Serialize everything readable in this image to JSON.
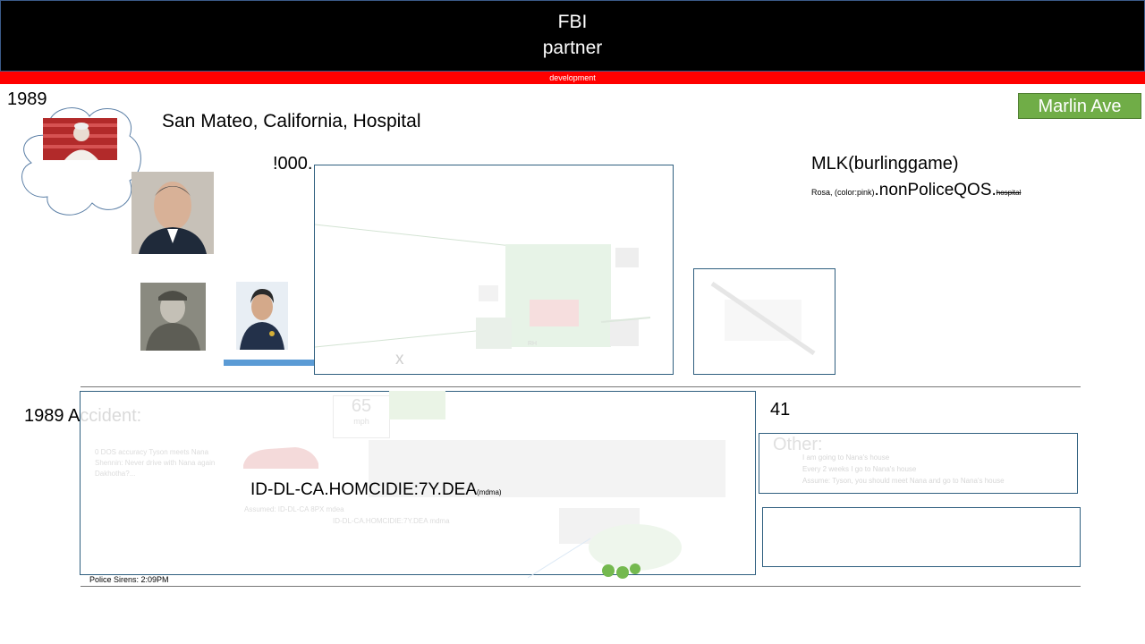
{
  "header": {
    "title_line1": "FBI",
    "title_line2": "partner",
    "subbar_text": "development"
  },
  "top": {
    "year": "1989",
    "location": "San Mateo, California, Hospital",
    "marlin_button": "Marlin Ave",
    "count_label": "!000.",
    "mlk_title": "MLK(burlinggame)",
    "rosa_prefix": "Rosa, (color:pink)",
    "rosa_main": ".nonPoliceQOS.",
    "rosa_strike": "hospital",
    "map_x_label": "x",
    "map_caption": "RH"
  },
  "accident": {
    "title": "1989 Accident:",
    "speed_value": "65",
    "speed_unit": "mph",
    "faint_notes": [
      "0 DOS accuracy Tyson meets Nana",
      "Shennin: Never drive with Nana again",
      "Dakhotha?..."
    ],
    "id_main": "ID-DL-CA.HOMCIDIE:7Y.DEA",
    "id_sub": "(mdma)",
    "assumed_text": "Assumed: ID-DL-CA 8PX mdea",
    "faint_id_line": "ID-DL-CA.HOMCIDIE:7Y.DEA mdma",
    "police_sirens": "Police Sirens: 2:09PM"
  },
  "right_panel": {
    "number": "41",
    "other_title": "Other:",
    "other_lines": [
      "I am going to Nana's house",
      "Every 2 weeks I go to Nana's house",
      "Assume: Tyson, you should meet Nana and go to Nana's house"
    ]
  },
  "colors": {
    "banner_bg": "#000000",
    "red_bar": "#ff0000",
    "marlin_green": "#70ad47",
    "frame_border": "#2f5f7f",
    "blue_bar": "#5b9bd5"
  }
}
